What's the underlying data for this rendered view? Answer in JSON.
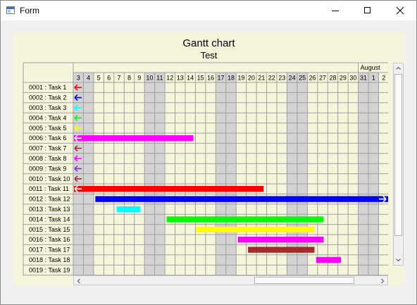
{
  "window": {
    "title": "Form"
  },
  "chart": {
    "title": "Gantt chart",
    "subtitle": "Test",
    "month_label": "August",
    "days": [
      "3",
      "4",
      "5",
      "6",
      "7",
      "8",
      "9",
      "10",
      "11",
      "12",
      "13",
      "14",
      "15",
      "16",
      "17",
      "18",
      "19",
      "20",
      "21",
      "22",
      "23",
      "24",
      "25",
      "26",
      "27",
      "28",
      "29",
      "30",
      "31",
      "1",
      "2"
    ],
    "weekend_days": [
      "3",
      "4",
      "10",
      "11",
      "17",
      "18",
      "24",
      "25",
      "31",
      "1"
    ],
    "tasks": [
      {
        "label": "0001 : Task 1",
        "color": "#ff0000",
        "start": 0,
        "end": 0,
        "arrow_left": true
      },
      {
        "label": "0002 : Task 2",
        "color": "#0000ff",
        "start": 0,
        "end": 0,
        "arrow_left": true
      },
      {
        "label": "0003 : Task 3",
        "color": "#00ffff",
        "start": 0,
        "end": 0,
        "arrow_left": true
      },
      {
        "label": "0004 : Task 4",
        "color": "#00ff00",
        "start": 0,
        "end": 0,
        "arrow_left": true
      },
      {
        "label": "0005 : Task 5",
        "color": "#ffff00",
        "start": 0,
        "end": 0,
        "arrow_left": true
      },
      {
        "label": "0006 : Task 6",
        "color": "#ff00ff",
        "start": 0,
        "end": 11.8,
        "arrow_left": true
      },
      {
        "label": "0007 : Task 7",
        "color": "#a52a2a",
        "start": 0,
        "end": 0,
        "arrow_left": true
      },
      {
        "label": "0008 : Task 8",
        "color": "#ff00ff",
        "start": 0,
        "end": 0,
        "arrow_left": true
      },
      {
        "label": "0009 : Task 9",
        "color": "#8a2be2",
        "start": 0,
        "end": 0,
        "arrow_left": true
      },
      {
        "label": "0010 : Task 10",
        "color": "#a52a2a",
        "start": 0,
        "end": 0,
        "arrow_left": true
      },
      {
        "label": "0011 : Task 11",
        "color": "#ff0000",
        "start": 0,
        "end": 18.7,
        "arrow_left": true
      },
      {
        "label": "0012 : Task 12",
        "color": "#0000ff",
        "start": 2.1,
        "end": 31,
        "arrow_right": true
      },
      {
        "label": "0013 : Task 13",
        "color": "#00ffff",
        "start": 4.2,
        "end": 6.6
      },
      {
        "label": "0014 : Task 14",
        "color": "#00ff00",
        "start": 9.1,
        "end": 24.6
      },
      {
        "label": "0015 : Task 15",
        "color": "#ffff00",
        "start": 12,
        "end": 23.7
      },
      {
        "label": "0016 : Task 16",
        "color": "#ff00ff",
        "start": 16.1,
        "end": 24.6
      },
      {
        "label": "0017 : Task 17",
        "color": "#a52a2a",
        "start": 17.1,
        "end": 23.7
      },
      {
        "label": "0018 : Task 18",
        "color": "#ff00ff",
        "start": 23.8,
        "end": 26.3
      },
      {
        "label": "0019 : Task 19",
        "color": "#ffffff",
        "start": 0,
        "end": 0
      }
    ]
  }
}
